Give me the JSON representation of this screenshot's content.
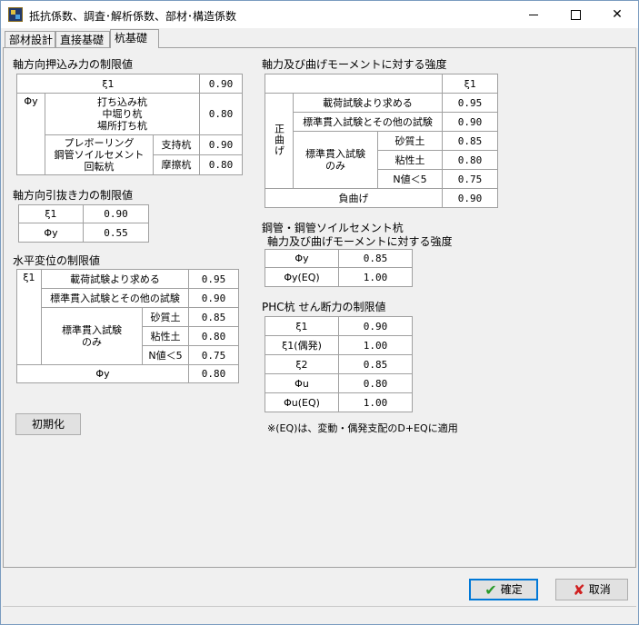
{
  "window": {
    "title": "抵抗係数、調査･解析係数、部材･構造係数",
    "controls": {
      "minimize": "",
      "maximize": "",
      "close": "✕"
    }
  },
  "tabs": [
    "部材設計",
    "直接基礎",
    "杭基礎"
  ],
  "active_tab": "杭基礎",
  "push": {
    "title": "軸方向押込み力の制限値",
    "xi1_label": "ξ1",
    "xi1_value": "0.90",
    "phiy_label": "Φy",
    "cast_label": "打ち込み杭\n中堀り杭\n場所打ち杭",
    "cast_value": "0.80",
    "bored_label": "プレボーリング\n鋼管ソイルセメント\n回転杭",
    "support_label": "支持杭",
    "support_value": "0.90",
    "friction_label": "摩擦杭",
    "friction_value": "0.80"
  },
  "pull": {
    "title": "軸方向引抜き力の制限値",
    "xi1_label": "ξ1",
    "xi1_value": "0.90",
    "phiy_label": "Φy",
    "phiy_value": "0.55"
  },
  "horiz": {
    "title": "水平変位の制限値",
    "xi1_label": "ξ1",
    "load_label": "載荷試験より求める",
    "load_value": "0.95",
    "spt_other_label": "標準貫入試験とその他の試験",
    "spt_other_value": "0.90",
    "spt_only_label": "標準貫入試験\nのみ",
    "sand_label": "砂質土",
    "sand_value": "0.85",
    "clay_label": "粘性土",
    "clay_value": "0.80",
    "nlt5_label": "N値＜5",
    "nlt5_value": "0.75",
    "phiy_label": "Φy",
    "phiy_value": "0.80"
  },
  "axial": {
    "title": "軸力及び曲げモーメントに対する強度",
    "xi1_header": "ξ1",
    "positive_label": "正曲げ",
    "load_label": "載荷試験より求める",
    "load_value": "0.95",
    "spt_other_label": "標準貫入試験とその他の試験",
    "spt_other_value": "0.90",
    "spt_only_label": "標準貫入試験\nのみ",
    "sand_label": "砂質土",
    "sand_value": "0.85",
    "clay_label": "粘性土",
    "clay_value": "0.80",
    "nlt5_label": "N値＜5",
    "nlt5_value": "0.75",
    "negative_label": "負曲げ",
    "negative_value": "0.90"
  },
  "steel": {
    "title": "鋼管・鋼管ソイルセメント杭",
    "subtitle": "軸力及び曲げモーメントに対する強度",
    "rows": [
      {
        "label": "Φy",
        "value": "0.85"
      },
      {
        "label": "Φy(EQ)",
        "value": "1.00"
      }
    ]
  },
  "phc": {
    "title": "PHC杭 せん断力の制限値",
    "rows": [
      {
        "label": "ξ1",
        "value": "0.90"
      },
      {
        "label": "ξ1(偶発)",
        "value": "1.00"
      },
      {
        "label": "ξ2",
        "value": "0.85"
      },
      {
        "label": "Φu",
        "value": "0.80"
      },
      {
        "label": "Φu(EQ)",
        "value": "1.00"
      }
    ]
  },
  "note": "※(EQ)は、変動・偶発支配のD+EQに適用",
  "buttons": {
    "reset": "初期化",
    "ok": "確定",
    "cancel": "取消"
  },
  "colors": {
    "ok_check": "#2a9a2a",
    "cancel_cross": "#d02020",
    "focus_border": "#0078d7"
  }
}
